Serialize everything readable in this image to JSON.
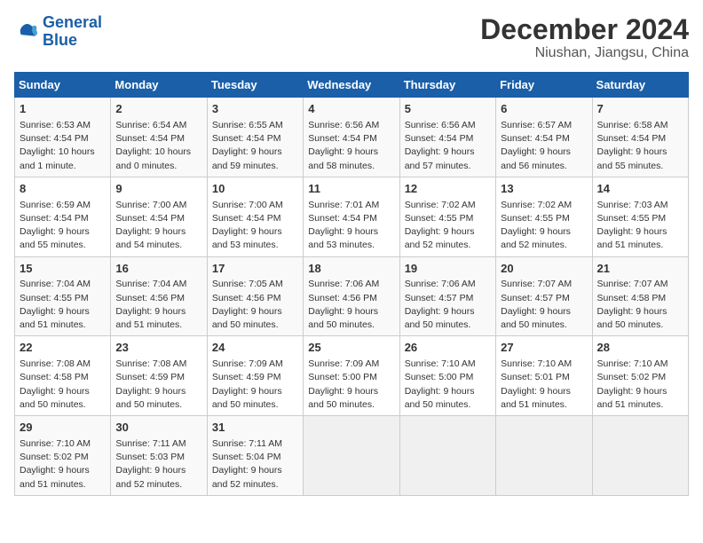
{
  "logo": {
    "line1": "General",
    "line2": "Blue"
  },
  "title": "December 2024",
  "subtitle": "Niushan, Jiangsu, China",
  "days_of_week": [
    "Sunday",
    "Monday",
    "Tuesday",
    "Wednesday",
    "Thursday",
    "Friday",
    "Saturday"
  ],
  "weeks": [
    [
      {
        "day": 1,
        "info": "Sunrise: 6:53 AM\nSunset: 4:54 PM\nDaylight: 10 hours\nand 1 minute."
      },
      {
        "day": 2,
        "info": "Sunrise: 6:54 AM\nSunset: 4:54 PM\nDaylight: 10 hours\nand 0 minutes."
      },
      {
        "day": 3,
        "info": "Sunrise: 6:55 AM\nSunset: 4:54 PM\nDaylight: 9 hours\nand 59 minutes."
      },
      {
        "day": 4,
        "info": "Sunrise: 6:56 AM\nSunset: 4:54 PM\nDaylight: 9 hours\nand 58 minutes."
      },
      {
        "day": 5,
        "info": "Sunrise: 6:56 AM\nSunset: 4:54 PM\nDaylight: 9 hours\nand 57 minutes."
      },
      {
        "day": 6,
        "info": "Sunrise: 6:57 AM\nSunset: 4:54 PM\nDaylight: 9 hours\nand 56 minutes."
      },
      {
        "day": 7,
        "info": "Sunrise: 6:58 AM\nSunset: 4:54 PM\nDaylight: 9 hours\nand 55 minutes."
      }
    ],
    [
      {
        "day": 8,
        "info": "Sunrise: 6:59 AM\nSunset: 4:54 PM\nDaylight: 9 hours\nand 55 minutes."
      },
      {
        "day": 9,
        "info": "Sunrise: 7:00 AM\nSunset: 4:54 PM\nDaylight: 9 hours\nand 54 minutes."
      },
      {
        "day": 10,
        "info": "Sunrise: 7:00 AM\nSunset: 4:54 PM\nDaylight: 9 hours\nand 53 minutes."
      },
      {
        "day": 11,
        "info": "Sunrise: 7:01 AM\nSunset: 4:54 PM\nDaylight: 9 hours\nand 53 minutes."
      },
      {
        "day": 12,
        "info": "Sunrise: 7:02 AM\nSunset: 4:55 PM\nDaylight: 9 hours\nand 52 minutes."
      },
      {
        "day": 13,
        "info": "Sunrise: 7:02 AM\nSunset: 4:55 PM\nDaylight: 9 hours\nand 52 minutes."
      },
      {
        "day": 14,
        "info": "Sunrise: 7:03 AM\nSunset: 4:55 PM\nDaylight: 9 hours\nand 51 minutes."
      }
    ],
    [
      {
        "day": 15,
        "info": "Sunrise: 7:04 AM\nSunset: 4:55 PM\nDaylight: 9 hours\nand 51 minutes."
      },
      {
        "day": 16,
        "info": "Sunrise: 7:04 AM\nSunset: 4:56 PM\nDaylight: 9 hours\nand 51 minutes."
      },
      {
        "day": 17,
        "info": "Sunrise: 7:05 AM\nSunset: 4:56 PM\nDaylight: 9 hours\nand 50 minutes."
      },
      {
        "day": 18,
        "info": "Sunrise: 7:06 AM\nSunset: 4:56 PM\nDaylight: 9 hours\nand 50 minutes."
      },
      {
        "day": 19,
        "info": "Sunrise: 7:06 AM\nSunset: 4:57 PM\nDaylight: 9 hours\nand 50 minutes."
      },
      {
        "day": 20,
        "info": "Sunrise: 7:07 AM\nSunset: 4:57 PM\nDaylight: 9 hours\nand 50 minutes."
      },
      {
        "day": 21,
        "info": "Sunrise: 7:07 AM\nSunset: 4:58 PM\nDaylight: 9 hours\nand 50 minutes."
      }
    ],
    [
      {
        "day": 22,
        "info": "Sunrise: 7:08 AM\nSunset: 4:58 PM\nDaylight: 9 hours\nand 50 minutes."
      },
      {
        "day": 23,
        "info": "Sunrise: 7:08 AM\nSunset: 4:59 PM\nDaylight: 9 hours\nand 50 minutes."
      },
      {
        "day": 24,
        "info": "Sunrise: 7:09 AM\nSunset: 4:59 PM\nDaylight: 9 hours\nand 50 minutes."
      },
      {
        "day": 25,
        "info": "Sunrise: 7:09 AM\nSunset: 5:00 PM\nDaylight: 9 hours\nand 50 minutes."
      },
      {
        "day": 26,
        "info": "Sunrise: 7:10 AM\nSunset: 5:00 PM\nDaylight: 9 hours\nand 50 minutes."
      },
      {
        "day": 27,
        "info": "Sunrise: 7:10 AM\nSunset: 5:01 PM\nDaylight: 9 hours\nand 51 minutes."
      },
      {
        "day": 28,
        "info": "Sunrise: 7:10 AM\nSunset: 5:02 PM\nDaylight: 9 hours\nand 51 minutes."
      }
    ],
    [
      {
        "day": 29,
        "info": "Sunrise: 7:10 AM\nSunset: 5:02 PM\nDaylight: 9 hours\nand 51 minutes."
      },
      {
        "day": 30,
        "info": "Sunrise: 7:11 AM\nSunset: 5:03 PM\nDaylight: 9 hours\nand 52 minutes."
      },
      {
        "day": 31,
        "info": "Sunrise: 7:11 AM\nSunset: 5:04 PM\nDaylight: 9 hours\nand 52 minutes."
      },
      null,
      null,
      null,
      null
    ]
  ]
}
